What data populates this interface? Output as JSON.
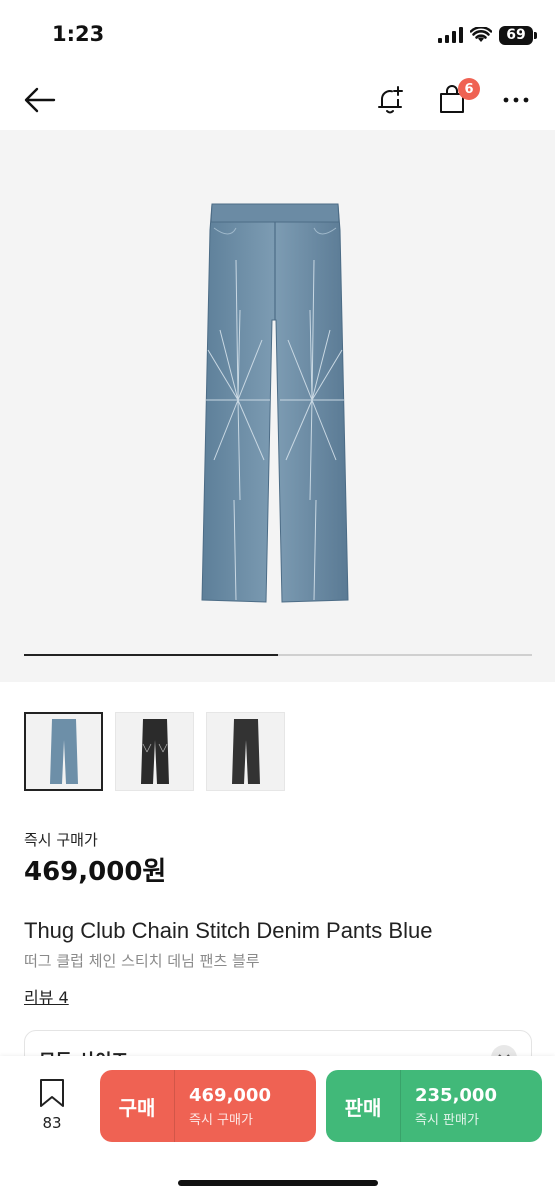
{
  "status_bar": {
    "time": "1:23",
    "battery": "69"
  },
  "nav": {
    "cart_badge": "6"
  },
  "gallery": {
    "progress": 0.5,
    "thumbnail_count": 3
  },
  "product": {
    "price_label": "즉시 구매가",
    "price": "469,000원",
    "title_en": "Thug Club Chain Stitch Denim Pants Blue",
    "title_ko": "떠그 클럽 체인 스티치 데님 팬츠 블루",
    "review_link": "리뷰 4"
  },
  "size_select": {
    "label": "모든 사이즈"
  },
  "bottom_bar": {
    "wish_count": "83",
    "buy": {
      "kind": "구매",
      "amount": "469,000",
      "sub": "즉시 구매가"
    },
    "sell": {
      "kind": "판매",
      "amount": "235,000",
      "sub": "즉시 판매가"
    }
  },
  "colors": {
    "buy": "#ef6253",
    "sell": "#41b979",
    "badge": "#ef6253",
    "denim": "#6d8fa8"
  },
  "icons": [
    "back-arrow-icon",
    "bell-plus-icon",
    "shopping-bag-icon",
    "more-icon",
    "bookmark-icon",
    "chevron-down-icon"
  ]
}
